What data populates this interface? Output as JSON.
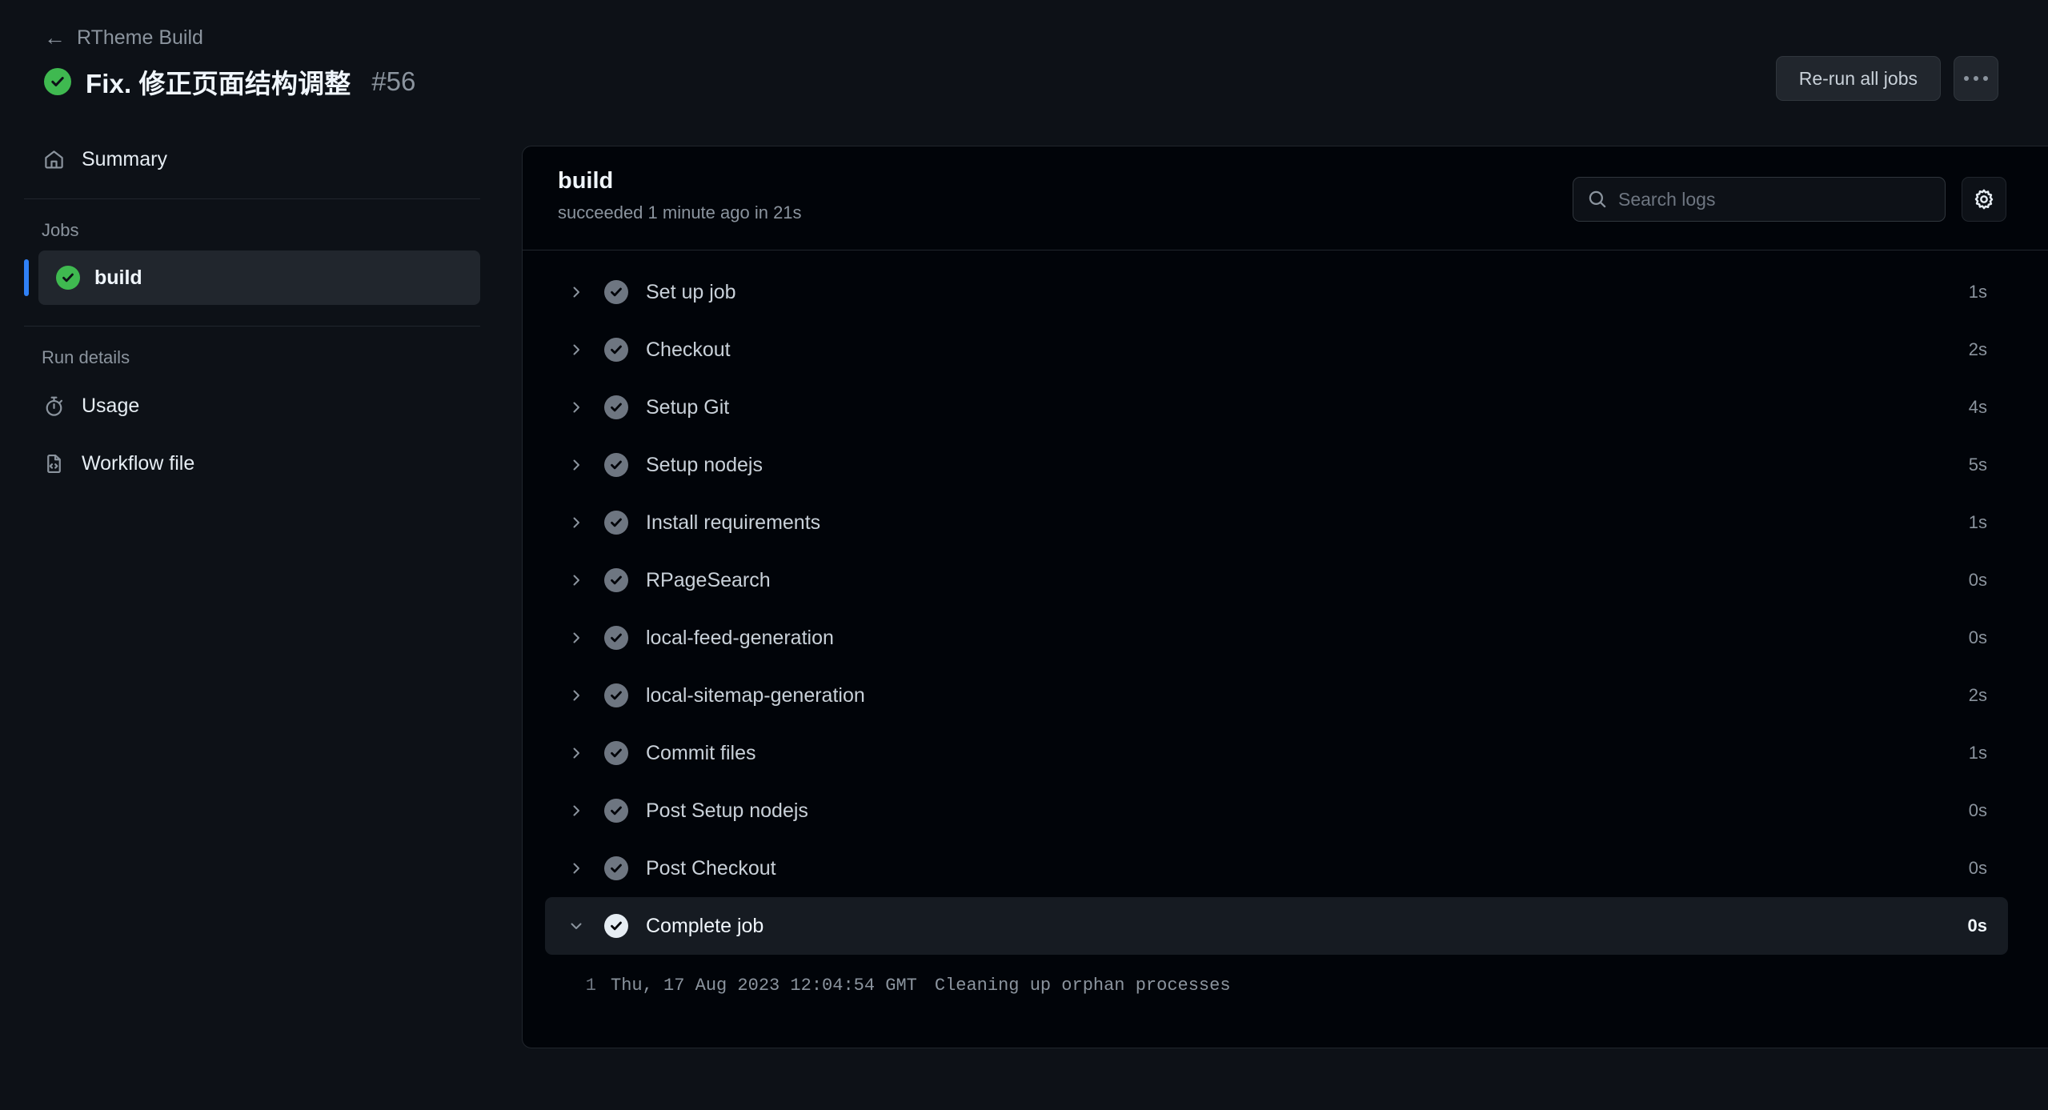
{
  "header": {
    "breadcrumb_back_icon": "arrow-left-icon",
    "breadcrumb_label": "RTheme Build",
    "status_icon": "success-check-icon",
    "title": "Fix. 修正页面结构调整",
    "run_number": "#56",
    "rerun_all_jobs_label": "Re-run all jobs",
    "kebab_icon": "kebab-horizontal-icon",
    "accent_success": "#3fb950",
    "accent_selected": "#2f81f7"
  },
  "sidebar": {
    "summary": {
      "icon": "home-icon",
      "label": "Summary"
    },
    "jobs_section_label": "Jobs",
    "jobs": [
      {
        "icon": "success-check-icon",
        "label": "build",
        "selected": true
      }
    ],
    "run_details_section_label": "Run details",
    "run_details": [
      {
        "icon": "stopwatch-icon",
        "label": "Usage"
      },
      {
        "icon": "file-code-icon",
        "label": "Workflow file"
      }
    ]
  },
  "log_panel": {
    "job_name": "build",
    "job_status": "succeeded 1 minute ago in 21s",
    "search": {
      "icon": "search-icon",
      "placeholder": "Search logs",
      "value": ""
    },
    "settings_icon": "gear-icon",
    "steps": [
      {
        "name": "Set up job",
        "duration": "1s",
        "expanded": false,
        "chevron": "chevron-right-icon"
      },
      {
        "name": "Checkout",
        "duration": "2s",
        "expanded": false,
        "chevron": "chevron-right-icon"
      },
      {
        "name": "Setup Git",
        "duration": "4s",
        "expanded": false,
        "chevron": "chevron-right-icon"
      },
      {
        "name": "Setup nodejs",
        "duration": "5s",
        "expanded": false,
        "chevron": "chevron-right-icon"
      },
      {
        "name": "Install requirements",
        "duration": "1s",
        "expanded": false,
        "chevron": "chevron-right-icon"
      },
      {
        "name": "RPageSearch",
        "duration": "0s",
        "expanded": false,
        "chevron": "chevron-right-icon"
      },
      {
        "name": "local-feed-generation",
        "duration": "0s",
        "expanded": false,
        "chevron": "chevron-right-icon"
      },
      {
        "name": "local-sitemap-generation",
        "duration": "2s",
        "expanded": false,
        "chevron": "chevron-right-icon"
      },
      {
        "name": "Commit files",
        "duration": "1s",
        "expanded": false,
        "chevron": "chevron-right-icon"
      },
      {
        "name": "Post Setup nodejs",
        "duration": "0s",
        "expanded": false,
        "chevron": "chevron-right-icon"
      },
      {
        "name": "Post Checkout",
        "duration": "0s",
        "expanded": false,
        "chevron": "chevron-right-icon"
      },
      {
        "name": "Complete job",
        "duration": "0s",
        "expanded": true,
        "chevron": "chevron-down-icon"
      }
    ],
    "log_lines": [
      {
        "number": "1",
        "timestamp": "Thu, 17 Aug 2023 12:04:54 GMT",
        "text": "Cleaning up orphan processes"
      }
    ]
  }
}
